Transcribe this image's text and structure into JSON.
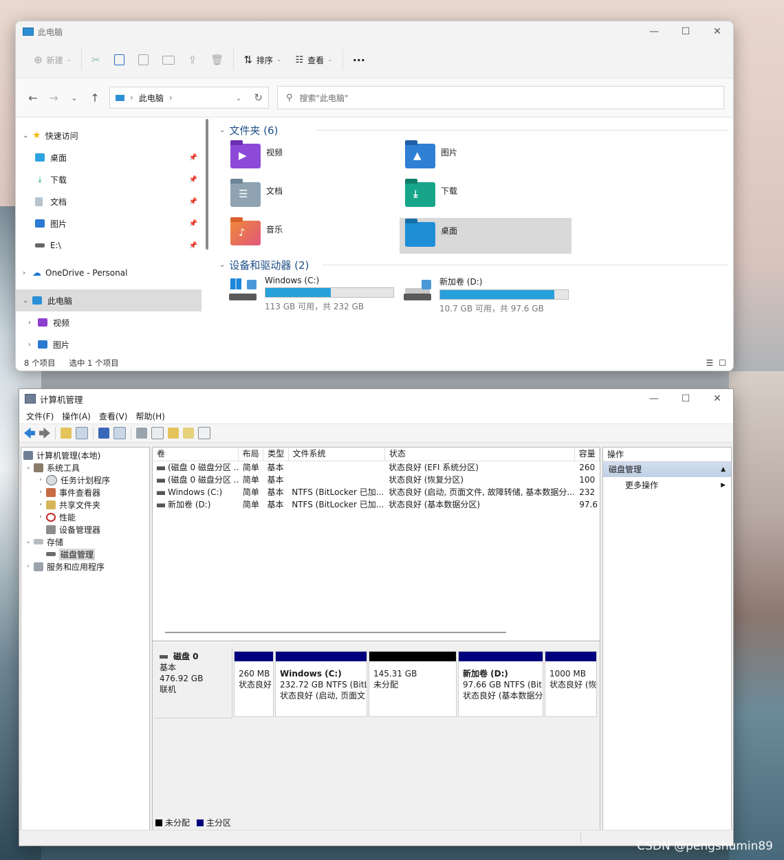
{
  "explorer": {
    "title": "此电脑",
    "window_controls": [
      "—",
      "☐",
      "✕"
    ],
    "toolbar": {
      "new_label": "新建",
      "sort_label": "排序",
      "view_label": "查看",
      "more_label": "···"
    },
    "nav": {
      "address_label": "此电脑",
      "search_placeholder": "搜索\"此电脑\""
    },
    "tree": {
      "quick_access": "快速访问",
      "items": [
        "桌面",
        "下载",
        "文档",
        "图片",
        "E:\\"
      ],
      "onedrive": "OneDrive - Personal",
      "this_pc": "此电脑",
      "sub_items": [
        "视频",
        "图片"
      ]
    },
    "folders_header": "文件夹 (6)",
    "folders": [
      "视频",
      "图片",
      "文档",
      "下载",
      "音乐",
      "桌面"
    ],
    "drives_header": "设备和驱动器 (2)",
    "drives": [
      {
        "name": "Windows (C:)",
        "free": "113 GB 可用，共 232 GB",
        "used_fraction": 0.51
      },
      {
        "name": "新加卷 (D:)",
        "free": "10.7 GB 可用，共 97.6 GB",
        "used_fraction": 0.89
      }
    ],
    "status": {
      "count": "8 个项目",
      "selected": "选中 1 个项目"
    }
  },
  "mmc": {
    "title": "计算机管理",
    "menu": [
      "文件(F)",
      "操作(A)",
      "查看(V)",
      "帮助(H)"
    ],
    "tree": {
      "root": "计算机管理(本地)",
      "system_tools": "系统工具",
      "tools": [
        "任务计划程序",
        "事件查看器",
        "共享文件夹",
        "性能",
        "设备管理器"
      ],
      "storage": "存储",
      "disk_mgmt": "磁盘管理",
      "services": "服务和应用程序"
    },
    "columns": [
      "卷",
      "布局",
      "类型",
      "文件系统",
      "状态",
      "容量"
    ],
    "rows": [
      [
        "(磁盘 0 磁盘分区 ...",
        "简单",
        "基本",
        "",
        "状态良好 (EFI 系统分区)",
        "260"
      ],
      [
        "(磁盘 0 磁盘分区 ...",
        "简单",
        "基本",
        "",
        "状态良好 (恢复分区)",
        "100"
      ],
      [
        "Windows (C:)",
        "简单",
        "基本",
        "NTFS (BitLocker 已加...",
        "状态良好 (启动, 页面文件, 故障转储, 基本数据分...",
        "232"
      ],
      [
        "新加卷 (D:)",
        "简单",
        "基本",
        "NTFS (BitLocker 已加...",
        "状态良好 (基本数据分区)",
        "97.6"
      ]
    ],
    "disk": {
      "name": "磁盘 0",
      "type": "基本",
      "size": "476.92 GB",
      "state": "联机"
    },
    "partitions": [
      {
        "title": "",
        "line1": "260 MB",
        "line2": "状态良好",
        "color": "#00007f"
      },
      {
        "title": "Windows  (C:)",
        "line1": "232.72 GB NTFS (BitL",
        "line2": "状态良好 (启动, 页面文",
        "color": "#00007f"
      },
      {
        "title": "",
        "line1": "145.31 GB",
        "line2": "未分配",
        "color": "#000000"
      },
      {
        "title": "新加卷  (D:)",
        "line1": "97.66 GB NTFS (Bit",
        "line2": "状态良好 (基本数据分",
        "color": "#00007f"
      },
      {
        "title": "",
        "line1": "1000 MB",
        "line2": "状态良好 (恢",
        "color": "#00007f"
      }
    ],
    "legend": [
      "未分配",
      "主分区"
    ],
    "actions": {
      "header": "操作",
      "section": "磁盘管理",
      "more": "更多操作"
    }
  },
  "watermark": "CSDN @pengshumin89"
}
